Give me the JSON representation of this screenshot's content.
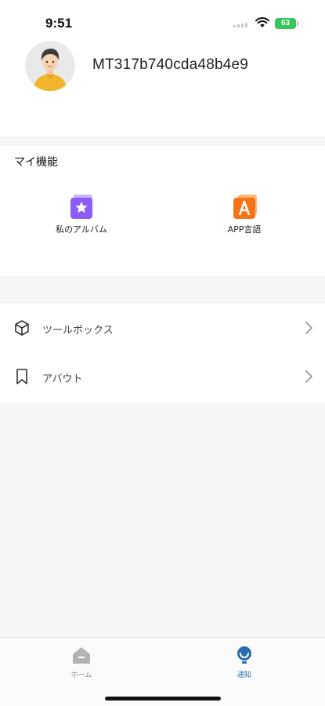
{
  "status_bar": {
    "time": "9:51",
    "battery": "63",
    "icons": [
      "signal-icon",
      "wifi-icon",
      "battery-icon"
    ]
  },
  "profile": {
    "username": "MT317b740cda48b4e9",
    "avatar_icon": "user-avatar-icon"
  },
  "features": {
    "title": "マイ機能",
    "items": [
      {
        "label": "私のアルバム",
        "icon": "album-star-icon",
        "color": "#8b5cf6"
      },
      {
        "label": "APP言語",
        "icon": "language-a-icon",
        "color": "#f97316"
      }
    ]
  },
  "menu": {
    "items": [
      {
        "label": "ツールボックス",
        "icon": "cube-icon"
      },
      {
        "label": "アバウト",
        "icon": "bookmark-icon"
      }
    ]
  },
  "tab_bar": {
    "tabs": [
      {
        "label": "ホーム",
        "icon": "home-icon",
        "active": false
      },
      {
        "label": "通知",
        "icon": "notification-icon",
        "active": true
      }
    ],
    "active_color": "#2b6cb0",
    "inactive_color": "#b3b3b3"
  }
}
